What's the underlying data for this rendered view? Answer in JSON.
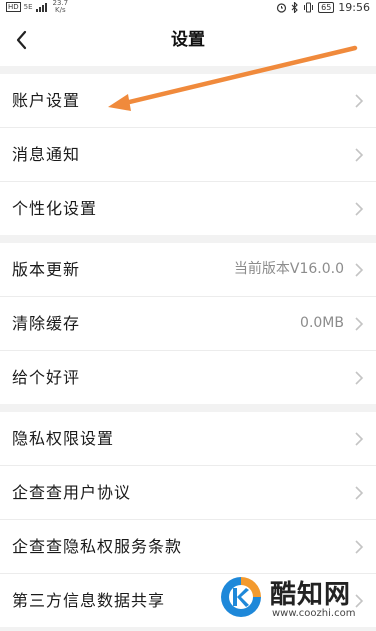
{
  "status_bar": {
    "hd": "HD",
    "network": "5E",
    "speed_value": "23.7",
    "speed_unit": "K/s",
    "battery": "65",
    "time": "19:56"
  },
  "nav": {
    "title": "设置"
  },
  "groups": [
    {
      "items": [
        {
          "label": "账户设置"
        },
        {
          "label": "消息通知"
        },
        {
          "label": "个性化设置"
        }
      ]
    },
    {
      "items": [
        {
          "label": "版本更新",
          "value": "当前版本V16.0.0"
        },
        {
          "label": "清除缓存",
          "value": "0.0MB"
        },
        {
          "label": "给个好评"
        }
      ]
    },
    {
      "items": [
        {
          "label": "隐私权限设置"
        },
        {
          "label": "企查查用户协议"
        },
        {
          "label": "企查查隐私权服务条款"
        },
        {
          "label": "第三方信息数据共享"
        }
      ]
    }
  ],
  "annotation": {
    "arrow_color": "#f08a3c"
  },
  "watermark": {
    "name": "酷知网",
    "url": "www.coozhi.com"
  }
}
